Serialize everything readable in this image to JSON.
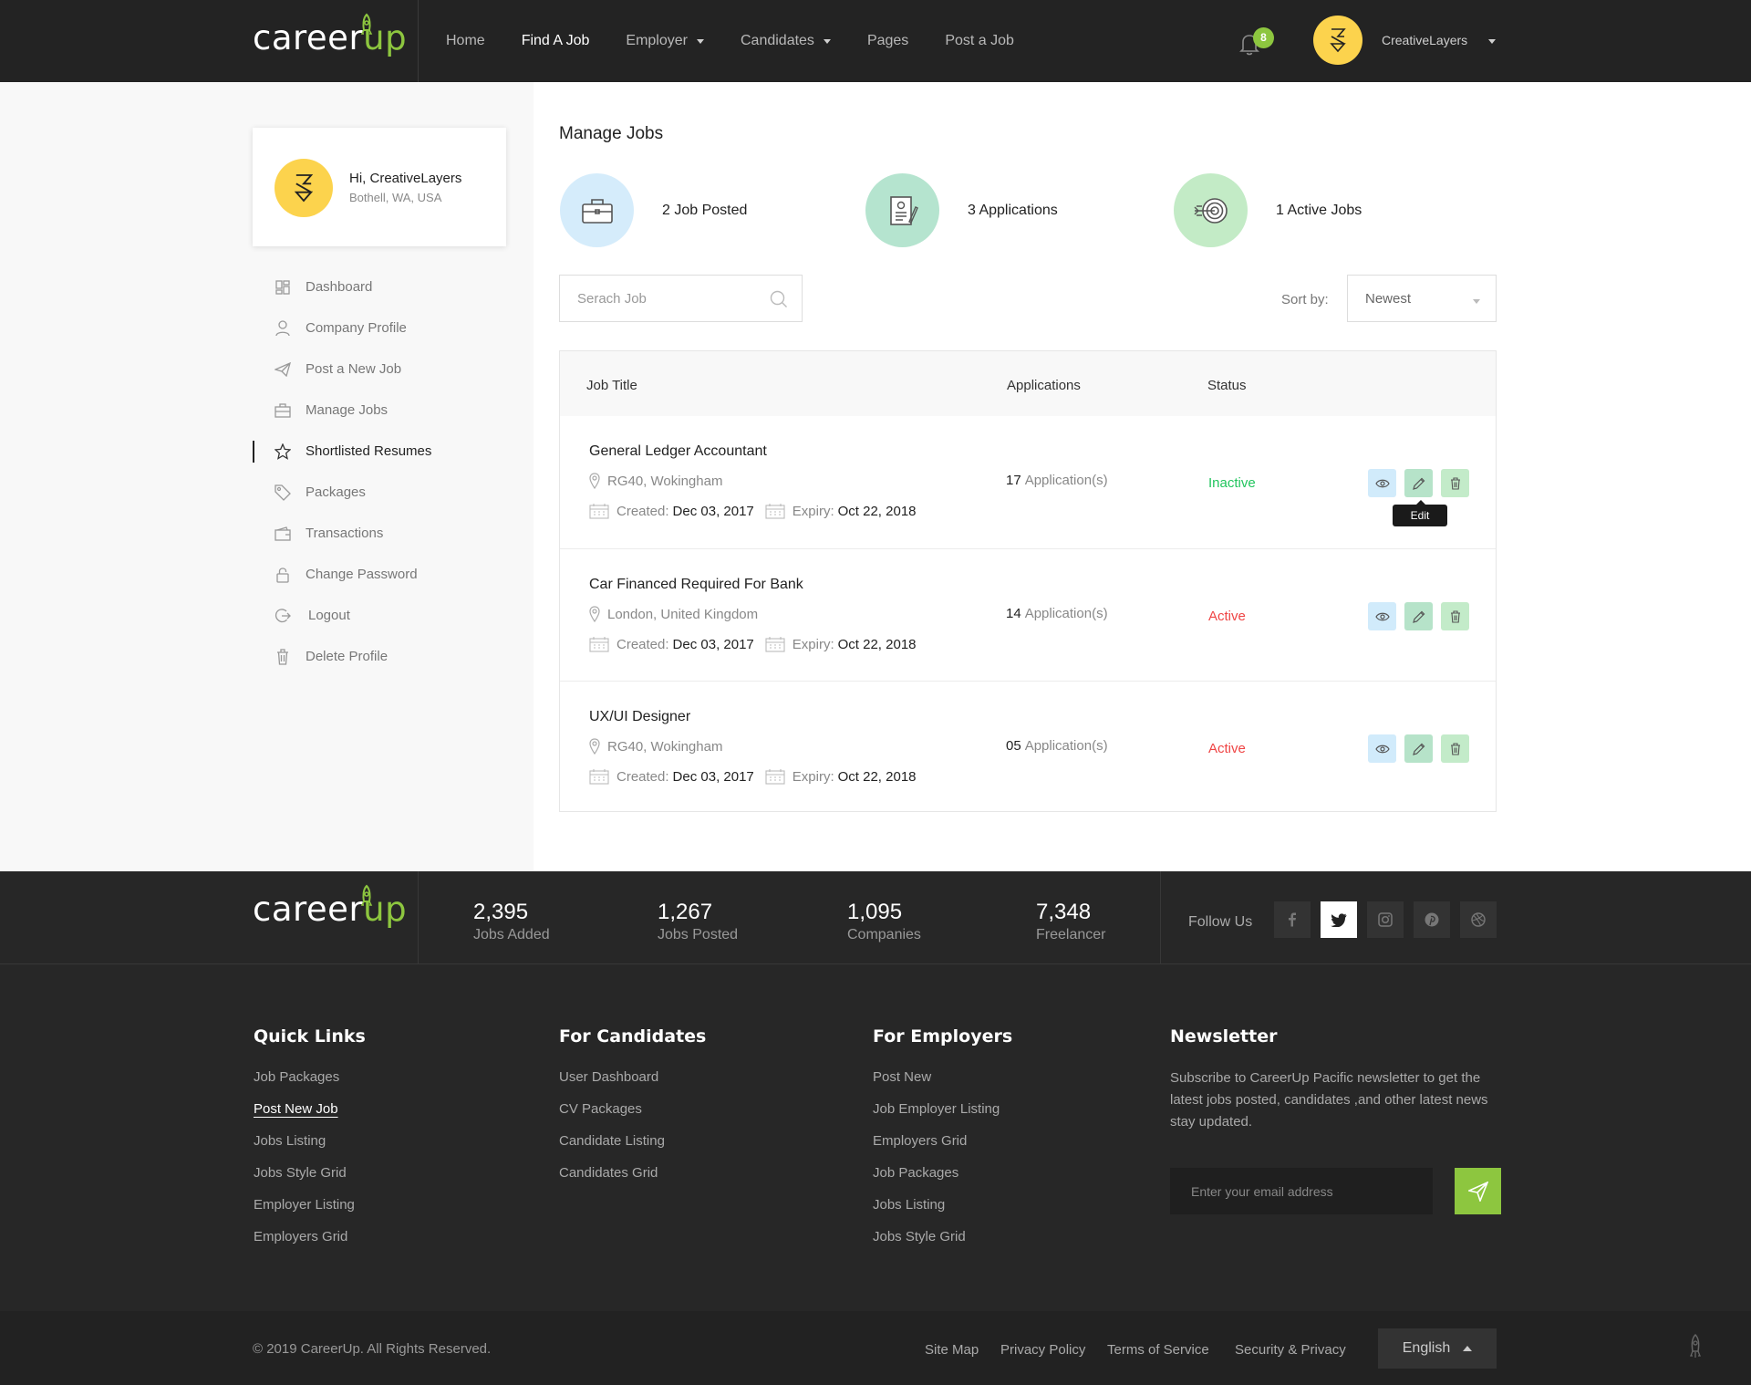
{
  "brand": {
    "word": "career",
    "suffix": "up"
  },
  "nav": {
    "items": [
      "Home",
      "Find A Job",
      "Employer",
      "Candidates",
      "Pages",
      "Post a Job"
    ],
    "active": "Find A Job"
  },
  "header": {
    "notifications_count": "8",
    "username": "CreativeLayers"
  },
  "profile": {
    "greeting": "Hi, CreativeLayers",
    "location": "Bothell, WA, USA"
  },
  "menu": {
    "items": [
      {
        "label": "Dashboard",
        "icon": "dashboard-icon"
      },
      {
        "label": "Company Profile",
        "icon": "user-icon"
      },
      {
        "label": "Post a New Job",
        "icon": "paper-plane-icon"
      },
      {
        "label": "Manage Jobs",
        "icon": "briefcase-icon"
      },
      {
        "label": "Shortlisted Resumes",
        "icon": "star-icon"
      },
      {
        "label": "Packages",
        "icon": "tag-icon"
      },
      {
        "label": "Transactions",
        "icon": "wallet-icon"
      },
      {
        "label": "Change Password",
        "icon": "lock-icon"
      },
      {
        "label": "Logout",
        "icon": "logout-icon"
      },
      {
        "label": "Delete Profile",
        "icon": "trash-icon"
      }
    ],
    "active": "Shortlisted Resumes"
  },
  "main": {
    "title": "Manage Jobs",
    "stats": [
      {
        "label": "2 Job Posted",
        "icon": "briefcase-icon",
        "color": "#d5ecfb"
      },
      {
        "label": "3 Applications",
        "icon": "document-icon",
        "color": "#b5e4cf"
      },
      {
        "label": "1 Active Jobs",
        "icon": "target-icon",
        "color": "#c3ebc6"
      }
    ],
    "search_placeholder": "Serach Job",
    "sort_label": "Sort by:",
    "sort_value": "Newest"
  },
  "table": {
    "headers": [
      "Job Title",
      "Applications",
      "Status"
    ],
    "rows": [
      {
        "title": "General Ledger Accountant",
        "location": "RG40, Wokingham",
        "created_label": "Created:",
        "created": "Dec 03, 2017",
        "expiry_label": "Expiry:",
        "expiry": "Oct 22, 2018",
        "apps_count": "17",
        "apps_text": "Application(s)",
        "status": "Inactive"
      },
      {
        "title": "Car Financed Required For Bank",
        "location": "London, United Kingdom",
        "created_label": "Created:",
        "created": "Dec 03, 2017",
        "expiry_label": "Expiry:",
        "expiry": "Oct 22, 2018",
        "apps_count": "14",
        "apps_text": "Application(s)",
        "status": "Active"
      },
      {
        "title": "UX/UI Designer",
        "location": "RG40, Wokingham",
        "created_label": "Created:",
        "created": "Dec 03, 2017",
        "expiry_label": "Expiry:",
        "expiry": "Oct 22, 2018",
        "apps_count": "05",
        "apps_text": "Application(s)",
        "status": "Active"
      }
    ],
    "tooltip": "Edit"
  },
  "footer": {
    "stats": [
      {
        "number": "2,395",
        "label": "Jobs Added"
      },
      {
        "number": "1,267",
        "label": "Jobs Posted"
      },
      {
        "number": "1,095",
        "label": "Companies"
      },
      {
        "number": "7,348",
        "label": "Freelancer"
      }
    ],
    "follow_label": "Follow Us",
    "social": [
      "facebook-icon",
      "twitter-icon",
      "instagram-icon",
      "pinterest-icon",
      "dribbble-icon"
    ],
    "columns": [
      {
        "title": "Quick Links",
        "links": [
          "Job Packages",
          "Post New Job",
          "Jobs Listing",
          "Jobs Style Grid",
          "Employer Listing",
          "Employers Grid"
        ]
      },
      {
        "title": "For Candidates",
        "links": [
          "User Dashboard",
          "CV Packages",
          "Candidate Listing",
          "Candidates Grid"
        ]
      },
      {
        "title": "For Employers",
        "links": [
          "Post New",
          "Job Employer Listing",
          "Employers Grid",
          "Job Packages",
          "Jobs Listing",
          "Jobs Style Grid"
        ]
      }
    ],
    "newsletter": {
      "title": "Newsletter",
      "text": "Subscribe to CareerUp Pacific newsletter to get the latest jobs posted, candidates ,and other latest news stay updated.",
      "placeholder": "Enter your email address"
    },
    "copyright": "© 2019 CareerUp. All Rights Reserved.",
    "bottom_links": [
      "Site Map",
      "Privacy Policy",
      "Terms of Service",
      "Security & Privacy"
    ],
    "language": "English"
  },
  "colors": {
    "accent": "#8dc63f",
    "header_bg": "#232323",
    "footer_bg": "#272727",
    "status_inactive": "#22c55e",
    "status_active": "#ef4444"
  }
}
